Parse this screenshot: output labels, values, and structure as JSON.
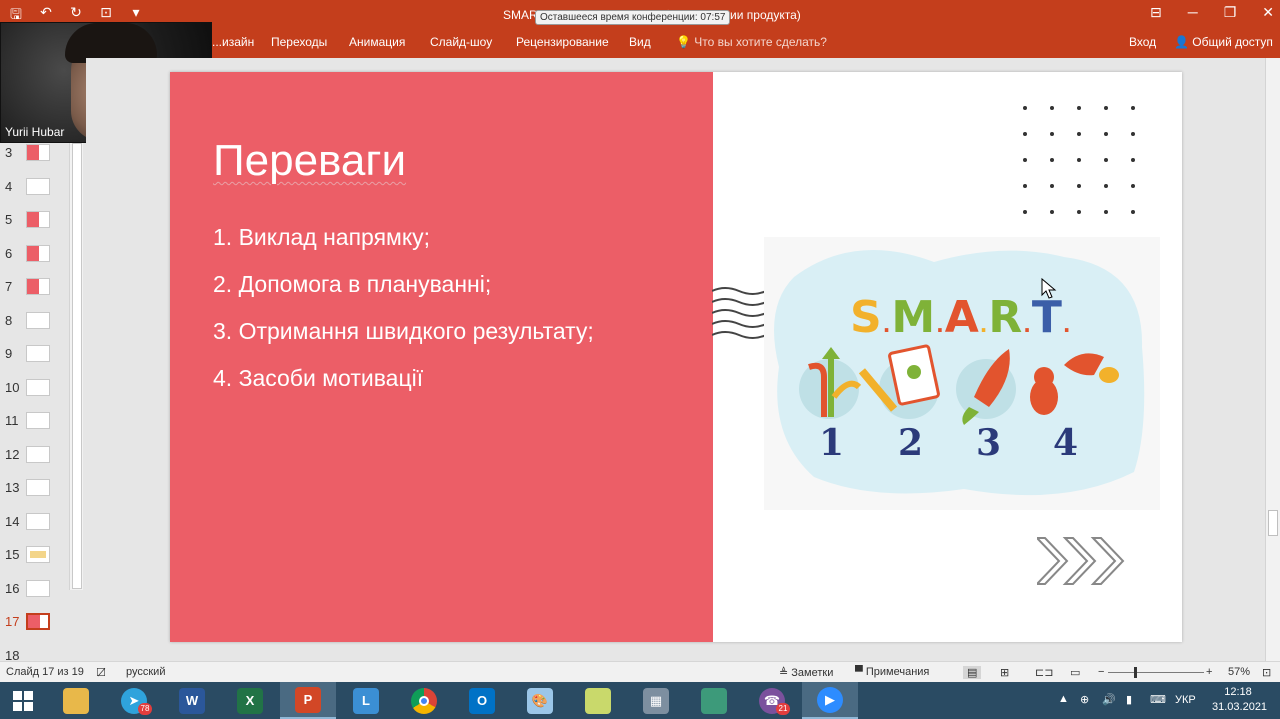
{
  "titlebar": {
    "doc_title": "SMART-цель - PowerPoint (Сбой активации продукта)",
    "conference_timer": "Оставшееся время конференции: 07:57"
  },
  "ribbon": {
    "tabs": [
      "...изайн",
      "Переходы",
      "Анимация",
      "Слайд-шоу",
      "Рецензирование",
      "Вид"
    ],
    "tell_me": "Что вы хотите сделать?",
    "sign_in": "Вход",
    "share": "Общий доступ"
  },
  "webcam": {
    "name": "Yurii Hubar"
  },
  "thumbnails": [
    {
      "num": "3"
    },
    {
      "num": "4"
    },
    {
      "num": "5"
    },
    {
      "num": "6"
    },
    {
      "num": "7"
    },
    {
      "num": "8"
    },
    {
      "num": "9"
    },
    {
      "num": "10"
    },
    {
      "num": "11"
    },
    {
      "num": "12"
    },
    {
      "num": "13"
    },
    {
      "num": "14"
    },
    {
      "num": "15"
    },
    {
      "num": "16"
    },
    {
      "num": "17"
    },
    {
      "num": "18"
    }
  ],
  "active_slide": "17",
  "slide": {
    "title": "Переваги",
    "items": [
      "1. Виклад напрямку;",
      "2. Допомога в плануванні;",
      "3. Отримання швидкого результату;",
      "4. Засоби мотивації"
    ],
    "smart_letters": [
      "S",
      ".",
      "M",
      ".",
      "A",
      ".",
      "R",
      ".",
      "T",
      "."
    ],
    "smart_numbers": [
      "1",
      "2",
      "3",
      "4"
    ]
  },
  "statusbar": {
    "slide_counter": "Слайд 17 из 19",
    "language": "русский",
    "notes": "Заметки",
    "comments": "Примечания",
    "zoom": "57%"
  },
  "taskbar": {
    "telegram_badge": "78",
    "viber_badge": "21",
    "lang": "УКР",
    "time": "12:18",
    "date": "31.03.2021"
  },
  "colors": {
    "accent": "#c43e1c",
    "slide_pink": "#ec5e67",
    "taskbar": "#2a4b63"
  }
}
